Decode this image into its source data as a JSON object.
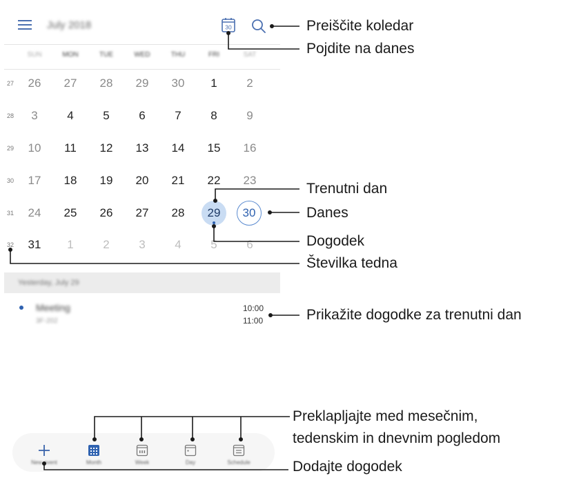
{
  "header": {
    "month_title": "July 2018",
    "menu_icon": "hamburger-menu-icon",
    "today_icon_number": "30",
    "search_icon": "search-icon"
  },
  "weekdays": [
    "SUN",
    "MON",
    "TUE",
    "WED",
    "THU",
    "FRI",
    "SAT"
  ],
  "weeks": [
    {
      "number": "27",
      "days": [
        "26",
        "27",
        "28",
        "29",
        "30",
        "1",
        "2"
      ]
    },
    {
      "number": "28",
      "days": [
        "3",
        "4",
        "5",
        "6",
        "7",
        "8",
        "9"
      ]
    },
    {
      "number": "29",
      "days": [
        "10",
        "11",
        "12",
        "13",
        "14",
        "15",
        "16"
      ]
    },
    {
      "number": "30",
      "days": [
        "17",
        "18",
        "19",
        "20",
        "21",
        "22",
        "23"
      ]
    },
    {
      "number": "31",
      "days": [
        "24",
        "25",
        "26",
        "27",
        "28",
        "29",
        "30"
      ]
    },
    {
      "number": "32",
      "days": [
        "31",
        "1",
        "2",
        "3",
        "4",
        "5",
        "6"
      ]
    }
  ],
  "events": {
    "header": "Yesterday, July 29",
    "items": [
      {
        "title": "Meeting",
        "location": "3F-202",
        "start": "10:00",
        "end": "11:00"
      }
    ]
  },
  "bottom_nav": [
    {
      "label": "New event",
      "icon": "plus-icon"
    },
    {
      "label": "Month",
      "icon": "month-view-icon"
    },
    {
      "label": "Week",
      "icon": "week-view-icon"
    },
    {
      "label": "Day",
      "icon": "day-view-icon"
    },
    {
      "label": "Schedule",
      "icon": "schedule-view-icon"
    }
  ],
  "callouts": {
    "search": "Preiščite koledar",
    "go_today": "Pojdite na danes",
    "current_day": "Trenutni dan",
    "today": "Danes",
    "event": "Dogodek",
    "week_number": "Številka tedna",
    "show_events": "Prikažite dogodke za trenutni dan",
    "switch_view_1": "Preklapljajte med mesečnim,",
    "switch_view_2": "tedenskim in dnevnim pogledom",
    "add_event": "Dodajte dogodek"
  },
  "colors": {
    "accent": "#2f62b0",
    "selected_bg": "#c9dcf3",
    "callout_line": "#1a1a1a"
  }
}
